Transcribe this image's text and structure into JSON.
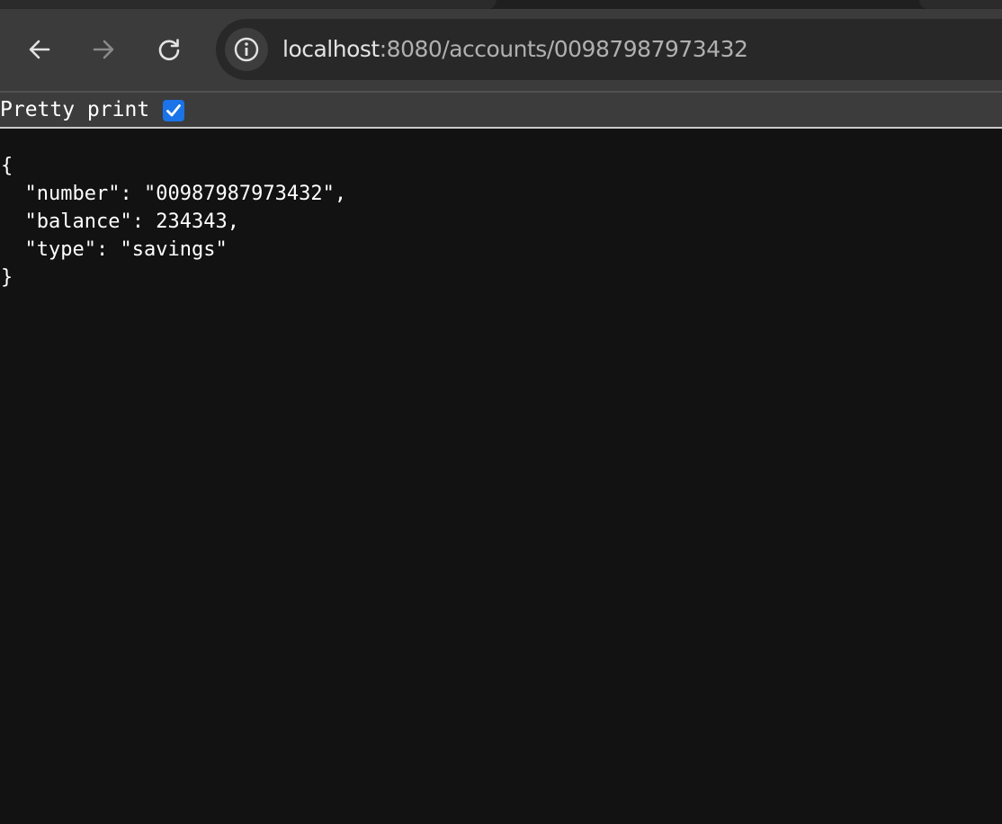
{
  "browser": {
    "url_host": "localhost",
    "url_path": ":8080/accounts/00987987973432",
    "icons": {
      "back": "arrow-left-icon",
      "forward": "arrow-right-icon",
      "reload": "reload-icon",
      "site_info": "info-icon"
    }
  },
  "viewer": {
    "pretty_print_label": "Pretty print",
    "pretty_print_checked": true
  },
  "json": {
    "open_brace": "{",
    "close_brace": "}",
    "lines": [
      {
        "key": "\"number\"",
        "sep": ": ",
        "value": "\"00987987973432\"",
        "trail": ","
      },
      {
        "key": "\"balance\"",
        "sep": ": ",
        "value": "234343",
        "trail": ","
      },
      {
        "key": "\"type\"",
        "sep": ": ",
        "value": "\"savings\"",
        "trail": ""
      }
    ]
  },
  "colors": {
    "page_bg": "#121212",
    "toolbar_bg": "#3b3b3b",
    "omnibox_bg": "#282828",
    "checkbox_accent": "#1a73e8"
  }
}
